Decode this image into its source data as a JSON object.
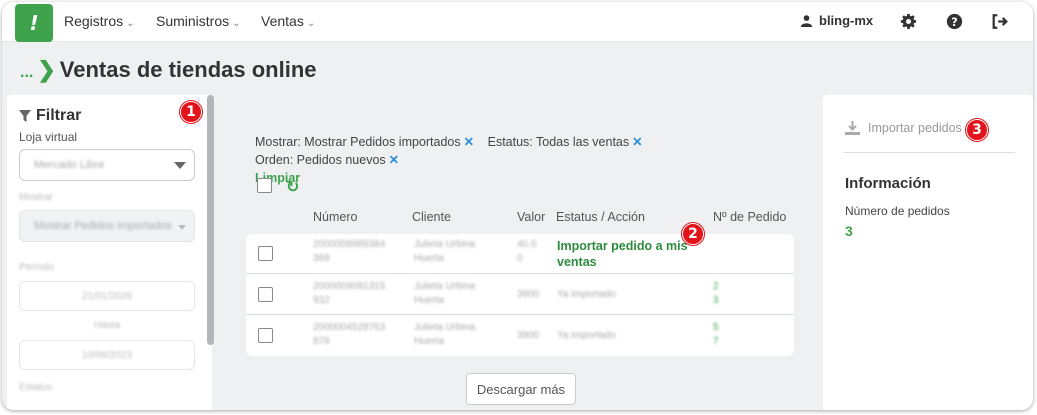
{
  "topbar": {
    "logo": "!",
    "nav": [
      {
        "label": "Registros"
      },
      {
        "label": "Suministros"
      },
      {
        "label": "Ventas"
      }
    ],
    "user": "bling-mx"
  },
  "breadcrumb": {
    "dots": "...",
    "title": "Ventas de tiendas online"
  },
  "sidebar": {
    "title": "Filtrar",
    "loja_label": "Loja virtual",
    "loja_value": "Mercado Libre",
    "mostrar_label": "Mostrar",
    "mostrar_value": "Mostrar Pedidos importados",
    "periodo_label": "Período",
    "date_from": "21/01/2026",
    "hasta": "Hasta",
    "date_to": "10/06/2023",
    "estatus_label": "Estatus"
  },
  "filters": {
    "chips": [
      {
        "label": "Mostrar: Mostrar Pedidos importados"
      },
      {
        "label": "Estatus: Todas las ventas"
      },
      {
        "label": "Orden: Pedidos nuevos"
      }
    ],
    "close_glyph": "✕",
    "clear": "Limpiar"
  },
  "table": {
    "headers": [
      "Número",
      "Cliente",
      "Valor",
      "Estatus / Acción",
      "Nº de Pedido"
    ],
    "rows": [
      {
        "numero_1": "2000008989384",
        "numero_2": "369",
        "cliente_1": "Julieta Urbina",
        "cliente_2": "Huerta",
        "valor_1": "40.0",
        "valor_2": "0",
        "accion": "Importar pedido a mis ventas",
        "pedido_1": "",
        "pedido_2": ""
      },
      {
        "numero_1": "2000009081315",
        "numero_2": "932",
        "cliente_1": "Julieta Urbina",
        "cliente_2": "Huerta",
        "valor_1": "3900",
        "valor_2": "",
        "accion": "Ya importado",
        "pedido_1": "2",
        "pedido_2": "3"
      },
      {
        "numero_1": "2000004528763",
        "numero_2": "878",
        "cliente_1": "Julieta Urbina",
        "cliente_2": "Huerta",
        "valor_1": "3900",
        "valor_2": "",
        "accion": "Ya importado",
        "pedido_1": "5",
        "pedido_2": "7"
      }
    ]
  },
  "load_more": "Descargar más",
  "right_panel": {
    "import_label": "Importar pedidos",
    "info_title": "Información",
    "count_label": "Número de pedidos",
    "count_value": "3"
  },
  "badges": [
    "1",
    "2",
    "3"
  ],
  "colors": {
    "brand_green": "#3fa34d",
    "badge_red": "#e3131b",
    "chip_x_blue": "#2f8fd8"
  }
}
